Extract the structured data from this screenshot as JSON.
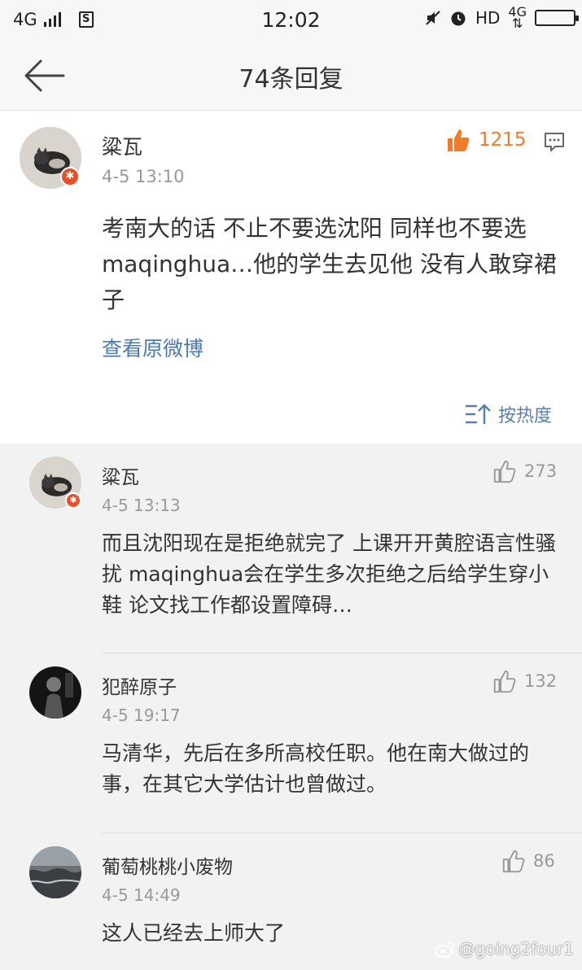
{
  "status_bar": {
    "network": "4G",
    "time": "12:02",
    "hd": "HD",
    "network_right": "4G"
  },
  "nav": {
    "title": "74条回复"
  },
  "main_comment": {
    "user": "粱瓦",
    "time": "4-5 13:10",
    "likes": "1215",
    "text": "考南大的话 不止不要选沈阳 同样也不要选maqinghua…他的学生去见他 没有人敢穿裙子",
    "view_original": "查看原微博",
    "sort_label": "按热度"
  },
  "replies": [
    {
      "user": "粱瓦",
      "time": "4-5 13:13",
      "likes": "273",
      "text": "而且沈阳现在是拒绝就完了 上课开开黄腔语言性骚扰 maqinghua会在学生多次拒绝之后给学生穿小鞋 论文找工作都设置障碍…"
    },
    {
      "user": "犯醉原子",
      "time": "4-5 19:17",
      "likes": "132",
      "text": "马清华，先后在多所高校任职。他在南大做过的事，在其它大学估计也曾做过。"
    },
    {
      "user": "葡萄桃桃小废物",
      "time": "4-5 14:49",
      "likes": "86",
      "text": "这人已经去上师大了"
    }
  ],
  "watermark": "@going2four1",
  "colors": {
    "accent_orange": "#f07c28",
    "link_blue": "#4a7ab0",
    "muted_gray": "#999999"
  }
}
